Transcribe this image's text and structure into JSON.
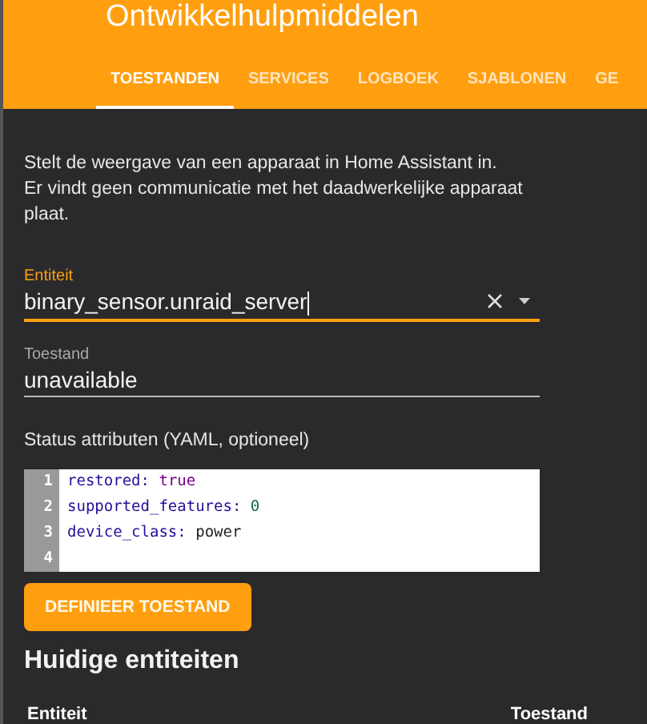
{
  "header": {
    "title": "Ontwikkelhulpmiddelen"
  },
  "tabs": [
    {
      "label": "TOESTANDEN",
      "selected": true
    },
    {
      "label": "SERVICES",
      "selected": false
    },
    {
      "label": "LOGBOEK",
      "selected": false
    },
    {
      "label": "SJABLONEN",
      "selected": false
    },
    {
      "label": "GE",
      "selected": false
    }
  ],
  "description": [
    "Stelt de weergave van een apparaat in Home Assistant in.",
    "Er vindt geen communicatie met het daadwerkelijke apparaat plaat."
  ],
  "entity_field": {
    "label": "Entiteit",
    "value": "binary_sensor.unraid_server",
    "focused": true
  },
  "state_field": {
    "label": "Toestand",
    "value": "unavailable",
    "focused": false
  },
  "attributes": {
    "label": "Status attributen (YAML, optioneel)",
    "lines": [
      {
        "number": "1",
        "key": "restored:",
        "value": "true",
        "kind": "keyword"
      },
      {
        "number": "2",
        "key": "supported_features:",
        "value": "0",
        "kind": "number"
      },
      {
        "number": "3",
        "key": "device_class:",
        "value": "power",
        "kind": "plain"
      },
      {
        "number": "4",
        "kind": "empty"
      }
    ]
  },
  "set_button": "DEFINIEER TOESTAND",
  "current": {
    "heading": "Huidige entiteiten",
    "columns": [
      "Entiteit",
      "Toestand"
    ]
  }
}
